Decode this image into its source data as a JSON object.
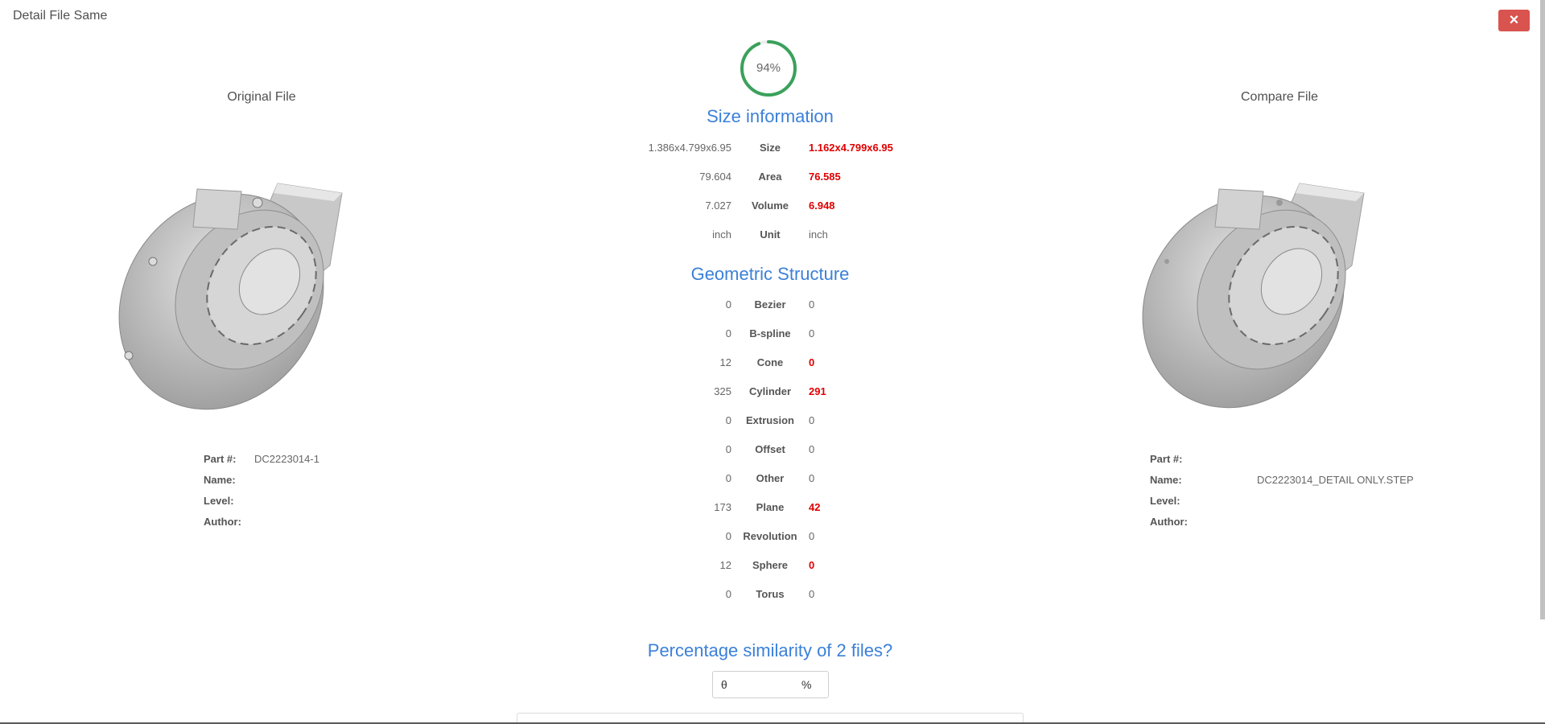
{
  "modal": {
    "title": "Detail File Same",
    "close_icon": "×"
  },
  "original": {
    "heading": "Original File",
    "meta": [
      {
        "label": "Part #:",
        "value": "DC2223014-1"
      },
      {
        "label": "Name:",
        "value": ""
      },
      {
        "label": "Level:",
        "value": ""
      },
      {
        "label": "Author:",
        "value": ""
      }
    ]
  },
  "compare": {
    "heading": "Compare File",
    "meta": [
      {
        "label": "Part #:",
        "value": ""
      },
      {
        "label": "Name:",
        "value": "DC2223014_DETAIL ONLY.STEP"
      },
      {
        "label": "Level:",
        "value": ""
      },
      {
        "label": "Author:",
        "value": ""
      }
    ]
  },
  "similarity": {
    "percent": 94,
    "label": "94%",
    "color": "#3aa15b"
  },
  "size_info": {
    "title": "Size information",
    "rows": [
      {
        "label": "Size",
        "original": "1.386x4.799x6.95",
        "compare": "1.162x4.799x6.95",
        "diff": true
      },
      {
        "label": "Area",
        "original": "79.604",
        "compare": "76.585",
        "diff": true
      },
      {
        "label": "Volume",
        "original": "7.027",
        "compare": "6.948",
        "diff": true
      },
      {
        "label": "Unit",
        "original": "inch",
        "compare": "inch",
        "diff": false
      }
    ]
  },
  "geometry": {
    "title": "Geometric Structure",
    "rows": [
      {
        "label": "Bezier",
        "original": "0",
        "compare": "0",
        "diff": false
      },
      {
        "label": "B-spline",
        "original": "0",
        "compare": "0",
        "diff": false
      },
      {
        "label": "Cone",
        "original": "12",
        "compare": "0",
        "diff": true
      },
      {
        "label": "Cylinder",
        "original": "325",
        "compare": "291",
        "diff": true
      },
      {
        "label": "Extrusion",
        "original": "0",
        "compare": "0",
        "diff": false
      },
      {
        "label": "Offset",
        "original": "0",
        "compare": "0",
        "diff": false
      },
      {
        "label": "Other",
        "original": "0",
        "compare": "0",
        "diff": false
      },
      {
        "label": "Plane",
        "original": "173",
        "compare": "42",
        "diff": true
      },
      {
        "label": "Revolution",
        "original": "0",
        "compare": "0",
        "diff": false
      },
      {
        "label": "Sphere",
        "original": "12",
        "compare": "0",
        "diff": true
      },
      {
        "label": "Torus",
        "original": "0",
        "compare": "0",
        "diff": false
      }
    ]
  },
  "percentage": {
    "title": "Percentage similarity of 2 files?",
    "input_value": "θ",
    "suffix": "%"
  },
  "colors": {
    "accent": "#3b80d9",
    "diff": "#e00000",
    "close": "#d9534f"
  }
}
